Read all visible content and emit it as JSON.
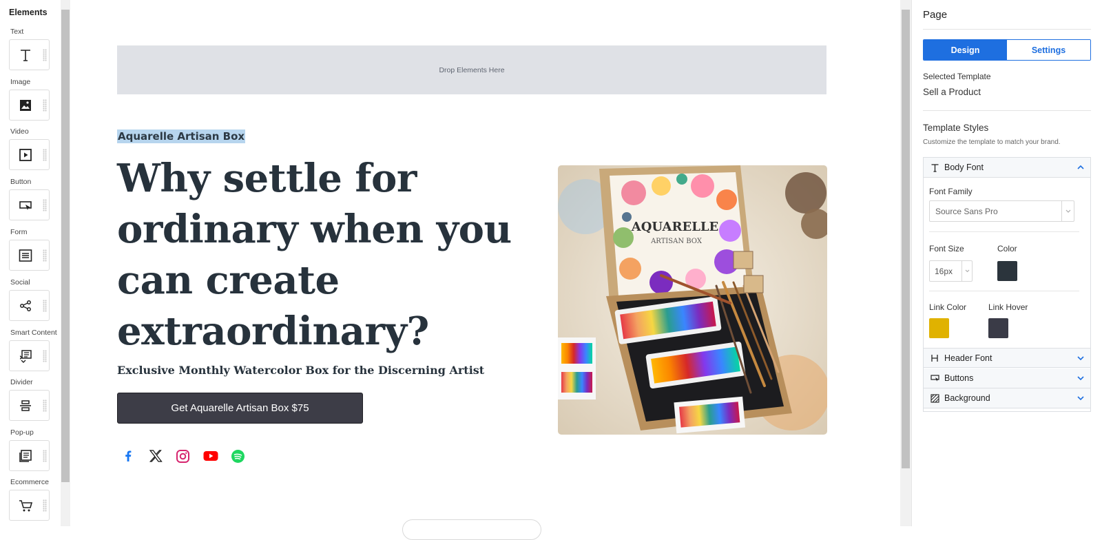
{
  "sidebar": {
    "title": "Elements",
    "items": [
      {
        "label": "Text",
        "icon": "text-icon"
      },
      {
        "label": "Image",
        "icon": "image-icon"
      },
      {
        "label": "Video",
        "icon": "video-icon"
      },
      {
        "label": "Button",
        "icon": "button-icon"
      },
      {
        "label": "Form",
        "icon": "form-icon"
      },
      {
        "label": "Social",
        "icon": "share-icon"
      },
      {
        "label": "Smart Content",
        "icon": "smart-content-icon"
      },
      {
        "label": "Divider",
        "icon": "divider-icon"
      },
      {
        "label": "Pop-up",
        "icon": "popup-icon"
      },
      {
        "label": "Ecommerce",
        "icon": "cart-icon"
      }
    ]
  },
  "canvas": {
    "dropzone_text": "Drop Elements Here",
    "brand_name": "Aquarelle Artisan Box",
    "headline": "Why settle for ordinary when you can create extraordinary?",
    "subheadline": "Exclusive Monthly Watercolor Box for the Discerning Artist",
    "cta_label": "Get Aquarelle Artisan Box $75",
    "hero_image_text": {
      "title": "AQUARELLE",
      "subtitle": "ARTISAN BOX"
    },
    "socials": [
      "facebook-icon",
      "x-icon",
      "instagram-icon",
      "youtube-icon",
      "spotify-icon"
    ]
  },
  "panel": {
    "title": "Page",
    "tabs": [
      {
        "label": "Design",
        "active": true
      },
      {
        "label": "Settings",
        "active": false
      }
    ],
    "selected_template_label": "Selected Template",
    "selected_template_value": "Sell a Product",
    "template_styles_title": "Template Styles",
    "template_styles_hint": "Customize the template to match your brand.",
    "body_font": {
      "title": "Body Font",
      "font_family_label": "Font Family",
      "font_family_value": "Source Sans Pro",
      "font_size_label": "Font Size",
      "font_size_value": "16px",
      "color_label": "Color",
      "color_value": "#2b343c",
      "link_color_label": "Link Color",
      "link_color_value": "#e0b200",
      "link_hover_label": "Link Hover",
      "link_hover_value": "#3a3b47"
    },
    "sections": [
      {
        "label": "Header Font",
        "icon": "header-icon"
      },
      {
        "label": "Buttons",
        "icon": "button-icon"
      },
      {
        "label": "Background",
        "icon": "background-icon"
      }
    ]
  },
  "colors": {
    "accent": "#1e6fe0",
    "cta_bg": "#3d3d47",
    "dropzone_bg": "#dfe1e6",
    "highlight": "#b7d5ee"
  }
}
